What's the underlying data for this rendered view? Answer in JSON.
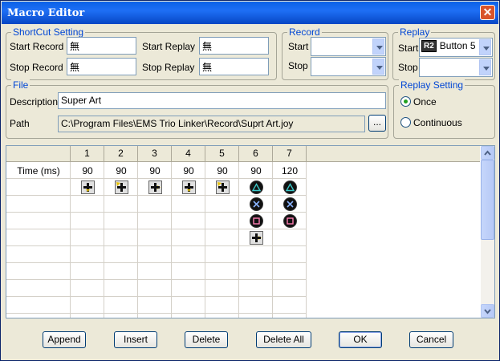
{
  "window": {
    "title": "Macro Editor",
    "close_symbol": "✕"
  },
  "shortcut": {
    "legend": "ShortCut Setting",
    "start_record_label": "Start Record",
    "start_record_value": "無",
    "stop_record_label": "Stop Record",
    "stop_record_value": "無",
    "start_replay_label": "Start Replay",
    "start_replay_value": "無",
    "stop_replay_label": "Stop Replay",
    "stop_replay_value": "無"
  },
  "record": {
    "legend": "Record",
    "start_label": "Start",
    "start_value": "",
    "stop_label": "Stop",
    "stop_value": ""
  },
  "replay": {
    "legend": "Replay",
    "start_label": "Start",
    "start_badge": "R2",
    "start_value": "Button 5",
    "stop_label": "Stop",
    "stop_value": ""
  },
  "file": {
    "legend": "File",
    "description_label": "Description",
    "description_value": "Super Art",
    "path_label": "Path",
    "path_value": "C:\\Program Files\\EMS Trio Linker\\Record\\Suprt Art.joy",
    "browse_label": "..."
  },
  "replay_setting": {
    "legend": "Replay Setting",
    "once_label": "Once",
    "continuous_label": "Continuous",
    "selected": "Once"
  },
  "grid": {
    "columns": [
      "1",
      "2",
      "3",
      "4",
      "5",
      "6",
      "7"
    ],
    "time_label": "Time (ms)",
    "times": [
      "90",
      "90",
      "90",
      "90",
      "90",
      "90",
      "120"
    ],
    "cells": [
      [
        "dpad-down-icon"
      ],
      [
        "dpad-up-left-icon"
      ],
      [
        "dpad-right-icon"
      ],
      [
        "dpad-down-icon"
      ],
      [
        "dpad-up-left-icon"
      ],
      [
        "triangle-button-icon",
        "cross-button-icon",
        "square-button-icon",
        "dpad-right-icon"
      ],
      [
        "triangle-button-icon",
        "cross-button-icon",
        "square-button-icon"
      ]
    ]
  },
  "buttons": {
    "append": "Append",
    "insert": "Insert",
    "delete": "Delete",
    "delete_all": "Delete All",
    "ok": "OK",
    "cancel": "Cancel"
  }
}
